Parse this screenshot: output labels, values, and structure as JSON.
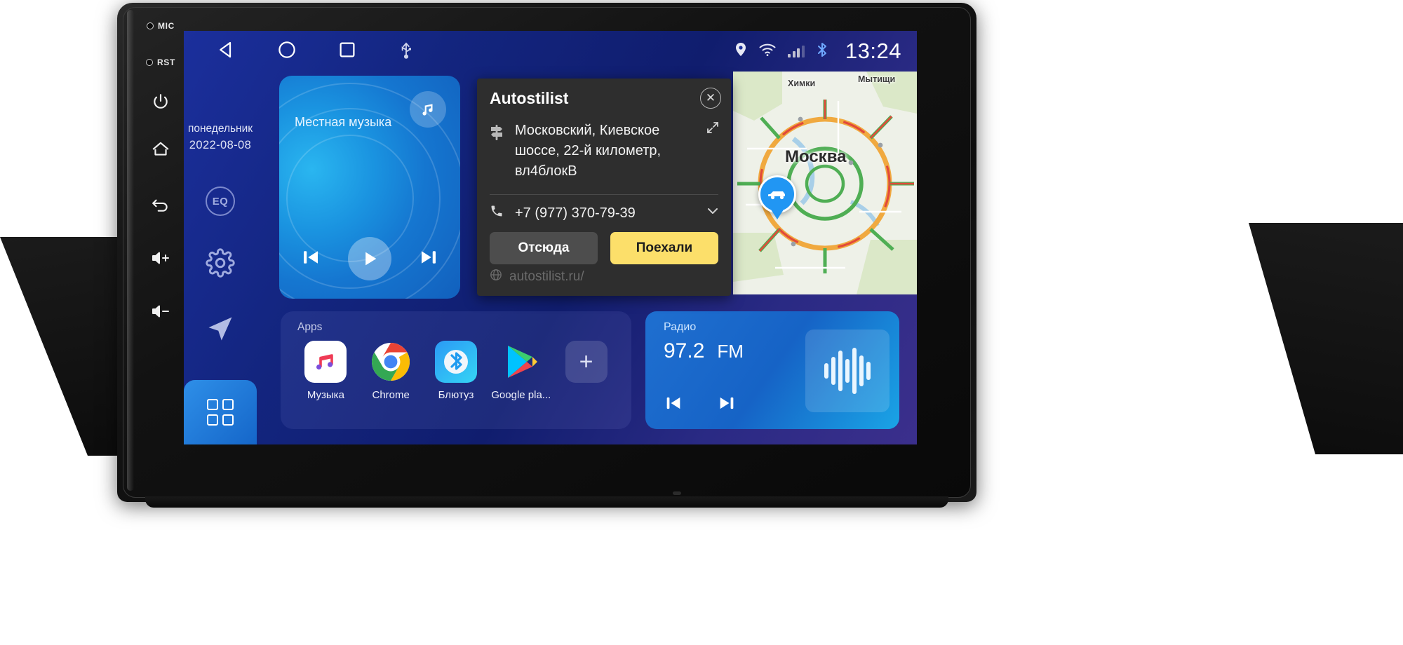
{
  "device": {
    "bezel_buttons": [
      {
        "name": "mic",
        "label": "MIC",
        "type": "hole"
      },
      {
        "name": "reset",
        "label": "RST",
        "type": "hole"
      },
      {
        "name": "power",
        "label": "",
        "type": "icon"
      },
      {
        "name": "home",
        "label": "",
        "type": "icon"
      },
      {
        "name": "back",
        "label": "",
        "type": "icon"
      },
      {
        "name": "volume-up",
        "label": "",
        "type": "icon"
      },
      {
        "name": "volume-down",
        "label": "",
        "type": "icon"
      }
    ]
  },
  "statusbar": {
    "nav_icons": [
      "back-triangle-icon",
      "home-circle-icon",
      "recents-square-icon",
      "usb-icon"
    ],
    "status_icons": [
      "location-pin-icon",
      "wifi-icon",
      "signal-bars-icon",
      "bluetooth-icon"
    ],
    "clock": "13:24"
  },
  "rail": {
    "weekday": "понедельник",
    "date": "2022-08-08",
    "items": [
      {
        "name": "eq",
        "label": "EQ"
      },
      {
        "name": "settings",
        "label": ""
      },
      {
        "name": "navigation",
        "label": ""
      }
    ],
    "apps_tab_label": ""
  },
  "music_card": {
    "title": "Местная музыка",
    "note_icon": "music-note-icon",
    "controls": [
      "previous-track",
      "play",
      "next-track"
    ]
  },
  "apps_card": {
    "label": "Apps",
    "items": [
      {
        "name": "music",
        "label": "Музыка",
        "icon": "apple-music-icon"
      },
      {
        "name": "chrome",
        "label": "Chrome",
        "icon": "chrome-icon"
      },
      {
        "name": "bluetooth",
        "label": "Блютуз",
        "icon": "bluetooth-icon"
      },
      {
        "name": "google-play",
        "label": "Google pla...",
        "icon": "google-play-icon"
      },
      {
        "name": "add",
        "label": "",
        "icon": "plus-icon"
      }
    ]
  },
  "radio_card": {
    "label": "Радио",
    "frequency": "97.2",
    "band": "FM",
    "controls": [
      "previous-station",
      "next-station"
    ],
    "visualizer_icon": "audio-waveform-icon"
  },
  "map": {
    "city_label": "Москва",
    "places": [
      {
        "name": "khimki",
        "label": "Химки"
      },
      {
        "name": "mytishchi",
        "label": "Мытищи"
      }
    ],
    "vehicle_pin_icon": "car-pin-icon"
  },
  "popup": {
    "title": "Autostilist",
    "close_label": "✕",
    "address_icon": "signpost-icon",
    "address": "Московский, Киевское шоссе, 22-й километр, вл4блокВ",
    "expand_icon": "expand-icon",
    "phone_icon": "phone-icon",
    "phone": "+7 (977) 370-79-39",
    "chevron_icon": "chevron-down-icon",
    "button_from": "Отсюда",
    "button_go": "Поехали",
    "url_icon": "globe-icon",
    "url": "autostilist.ru/"
  },
  "colors": {
    "accent_yellow": "#fcdf6a",
    "accent_blue": "#2196f3",
    "popup_bg": "#2e2e2e"
  }
}
